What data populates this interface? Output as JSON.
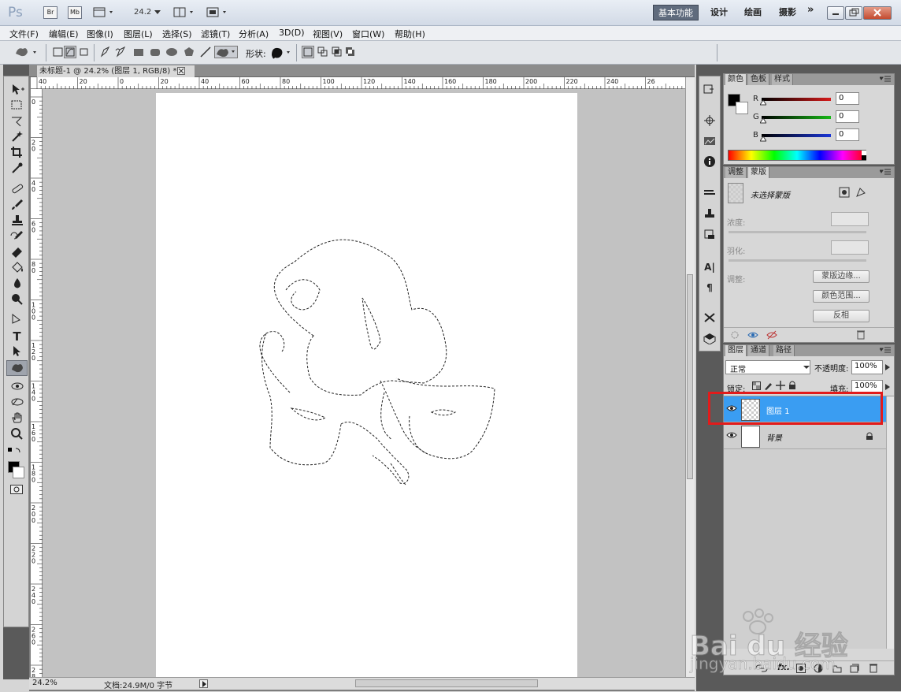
{
  "app": {
    "logo": "Ps",
    "br_label": "Br",
    "mb_label": "Mb",
    "zoom_value": "24.2",
    "workspaces": [
      "基本功能",
      "设计",
      "绘画",
      "摄影"
    ],
    "more_label": "»"
  },
  "menu": [
    "文件(F)",
    "编辑(E)",
    "图像(I)",
    "图层(L)",
    "选择(S)",
    "滤镜(T)",
    "分析(A)",
    "3D(D)",
    "视图(V)",
    "窗口(W)",
    "帮助(H)"
  ],
  "options": {
    "shape_label": "形状:"
  },
  "document": {
    "tab_title": "未标题-1 @ 24.2% (图层 1, RGB/8) *",
    "ruler_top": [
      "40",
      "20",
      "0",
      "20",
      "40",
      "60",
      "80",
      "100",
      "120",
      "140",
      "160",
      "180",
      "200",
      "220",
      "240",
      "26"
    ],
    "ruler_left": [
      "0",
      "2 0",
      "4 0",
      "6 0",
      "8 0",
      "1 0 0",
      "1 2 0",
      "1 4 0",
      "1 6 0",
      "1 8 0",
      "2 0 0",
      "2 2 0",
      "2 4 0",
      "2 6 0",
      "2 8 0"
    ],
    "status_zoom": "24.2%",
    "status_doc": "文档:24.9M/0 字节"
  },
  "color_panel": {
    "tabs": [
      "颜色",
      "色板",
      "样式"
    ],
    "channels": [
      {
        "label": "R",
        "value": "0",
        "color": "#d61a1a"
      },
      {
        "label": "G",
        "value": "0",
        "color": "#18b818"
      },
      {
        "label": "B",
        "value": "0",
        "color": "#1a36d6"
      }
    ]
  },
  "mask_panel": {
    "tabs": [
      "调整",
      "蒙版"
    ],
    "no_mask": "未选择蒙版",
    "density_label": "浓度:",
    "feather_label": "羽化:",
    "refine_label": "调整:",
    "btn_mask_edge": "蒙版边缘...",
    "btn_color_range": "颜色范围...",
    "btn_invert": "反相"
  },
  "layers_panel": {
    "tabs": [
      "图层",
      "通道",
      "路径"
    ],
    "blend_mode": "正常",
    "opacity_label": "不透明度:",
    "opacity_value": "100%",
    "lock_label": "锁定:",
    "fill_label": "填充:",
    "fill_value": "100%",
    "layers": [
      {
        "name": "图层 1",
        "selected": true
      },
      {
        "name": "背景",
        "selected": false
      }
    ],
    "highlight_color": "#3a9df2"
  },
  "watermark": {
    "brand": "Bai du 经验",
    "url": "jingyan.baidu.com"
  }
}
